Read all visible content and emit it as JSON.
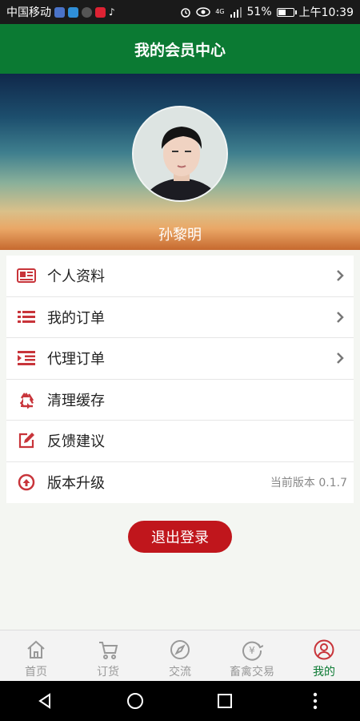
{
  "status_bar": {
    "carrier": "中国移动",
    "network": "4G",
    "battery": "51%",
    "battery_level": 0.51,
    "time": "上午10:39"
  },
  "header": {
    "title": "我的会员中心"
  },
  "profile": {
    "username": "孙黎明"
  },
  "menu": {
    "items": [
      {
        "label": "个人资料",
        "icon": "profile-card-icon"
      },
      {
        "label": "我的订单",
        "icon": "order-list-icon"
      },
      {
        "label": "代理订单",
        "icon": "agent-order-icon"
      },
      {
        "label": "清理缓存",
        "icon": "recycle-icon"
      },
      {
        "label": "反馈建议",
        "icon": "edit-icon"
      },
      {
        "label": "版本升级",
        "icon": "upgrade-icon",
        "value": "当前版本 0.1.7"
      }
    ]
  },
  "logout_label": "退出登录",
  "bottom_nav": {
    "items": [
      {
        "label": "首页",
        "icon": "home-icon"
      },
      {
        "label": "订货",
        "icon": "cart-icon"
      },
      {
        "label": "交流",
        "icon": "compass-icon"
      },
      {
        "label": "畜禽交易",
        "icon": "yuan-exchange-icon"
      },
      {
        "label": "我的",
        "icon": "user-icon",
        "active": true
      }
    ]
  },
  "colors": {
    "primary_green": "#0b7a33",
    "accent_red": "#c0161c",
    "icon_red": "#c8343a"
  }
}
